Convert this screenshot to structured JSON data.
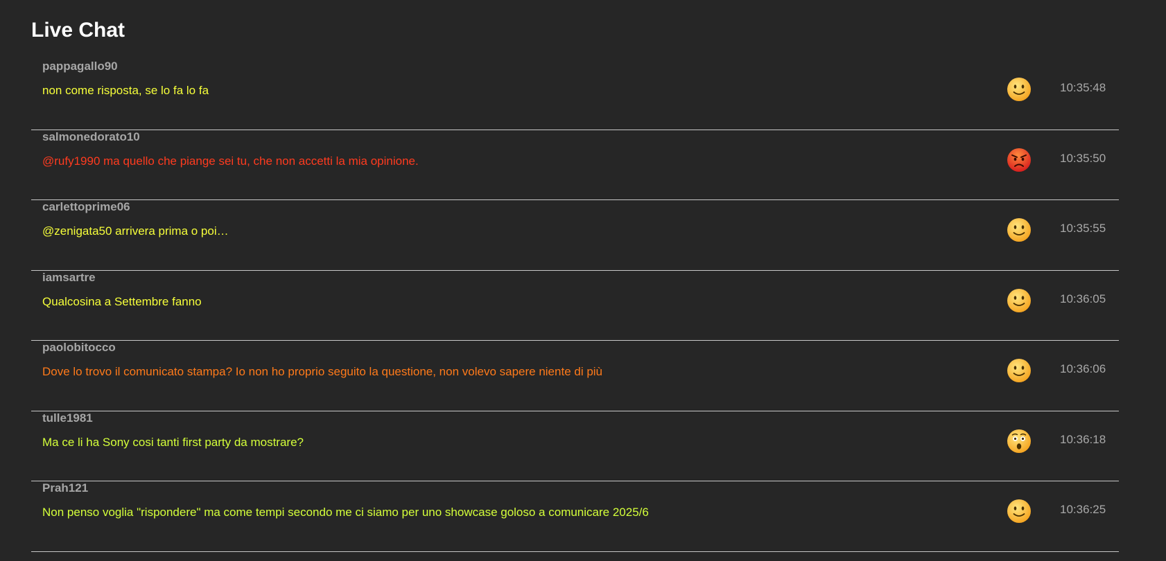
{
  "header": {
    "title": "Live Chat"
  },
  "messages": [
    {
      "user": "pappagallo90",
      "text": "non come risposta, se lo fa lo fa",
      "color": "#f6ff3a",
      "emoji": "slightly-smiling-face-icon",
      "time": "10:35:48"
    },
    {
      "user": "salmonedorato10",
      "text": "@rufy1990 ma quello che piange sei tu, che non accetti la mia opinione.",
      "color": "#ff3b1f",
      "emoji": "angry-face-icon",
      "time": "10:35:50"
    },
    {
      "user": "carlettoprime06",
      "text": "@zenigata50 arrivera prima o poi…",
      "color": "#f6ff3a",
      "emoji": "slightly-smiling-face-icon",
      "time": "10:35:55"
    },
    {
      "user": "iamsartre",
      "text": "Qualcosina a Settembre fanno",
      "color": "#f6ff3a",
      "emoji": "slightly-smiling-face-icon",
      "time": "10:36:05"
    },
    {
      "user": "paolobitocco",
      "text": "Dove lo trovo il comunicato stampa? Io non ho proprio seguito la questione, non volevo sapere niente di più",
      "color": "#ff7a1a",
      "emoji": "slightly-smiling-face-icon",
      "time": "10:36:06"
    },
    {
      "user": "tulle1981",
      "text": "Ma ce li ha Sony cosi tanti first party da mostrare?",
      "color": "#d4ff3a",
      "emoji": "astonished-face-icon",
      "time": "10:36:18"
    },
    {
      "user": "Prah121",
      "text": "Non penso voglia \"rispondere\" ma come tempi secondo me ci siamo per uno showcase goloso a comunicare 2025/6",
      "color": "#d4ff3a",
      "emoji": "slightly-smiling-face-icon",
      "time": "10:36:25"
    }
  ]
}
